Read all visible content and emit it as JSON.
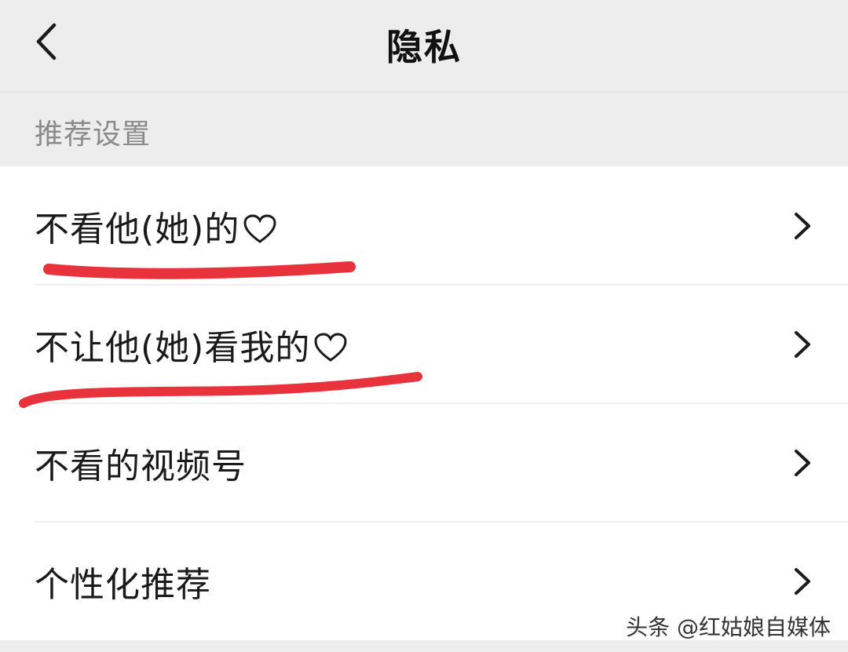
{
  "header": {
    "title": "隐私",
    "back_icon": "chevron-left-icon"
  },
  "section": {
    "label": "推荐设置"
  },
  "rows": [
    {
      "label": "不看他(她)的",
      "icon": "heart-outline-icon"
    },
    {
      "label": "不让他(她)看我的",
      "icon": "heart-outline-icon"
    },
    {
      "label": "不看的视频号"
    },
    {
      "label": "个性化推荐"
    }
  ],
  "watermark": "头条 @红姑娘自媒体",
  "colors": {
    "background": "#ededed",
    "list_background": "#ffffff",
    "annotation": "#e8323c",
    "section_label": "#8a8a8a"
  }
}
